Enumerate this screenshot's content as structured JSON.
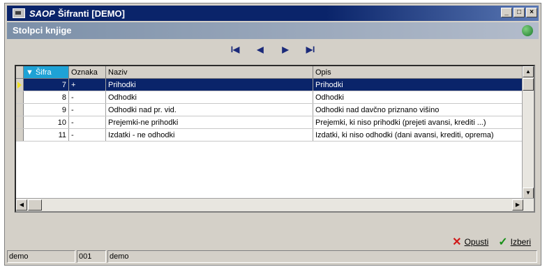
{
  "window": {
    "brand": "SAOP",
    "title": "Šifranti [DEMO]",
    "subtitle": "Stolpci knjige",
    "controls": {
      "minimize": "_",
      "maximize": "□",
      "close": "×"
    }
  },
  "nav": {
    "first": "I◀",
    "prev": "◀",
    "next": "▶",
    "last": "▶I"
  },
  "grid": {
    "columns": {
      "sifra": "Šifra",
      "oznaka": "Oznaka",
      "naziv": "Naziv",
      "opis": "Opis"
    },
    "rows": [
      {
        "sifra": "7",
        "oznaka": "+",
        "naziv": "Prihodki",
        "opis": "Prihodki"
      },
      {
        "sifra": "8",
        "oznaka": "-",
        "naziv": "Odhodki",
        "opis": "Odhodki"
      },
      {
        "sifra": "9",
        "oznaka": "-",
        "naziv": "Odhodki nad pr. vid.",
        "opis": "Odhodki nad davčno priznano višino"
      },
      {
        "sifra": "10",
        "oznaka": "-",
        "naziv": "Prejemki-ne prihodki",
        "opis": "Prejemki, ki niso prihodki (prejeti avansi, krediti ...)"
      },
      {
        "sifra": "11",
        "oznaka": "-",
        "naziv": "Izdatki - ne odhodki",
        "opis": "Izdatki, ki niso odhodki (dani avansi, krediti, oprema)"
      }
    ]
  },
  "actions": {
    "cancel": "Opusti",
    "select": "Izberi"
  },
  "status": {
    "user": "demo",
    "code": "001",
    "company": "demo"
  }
}
